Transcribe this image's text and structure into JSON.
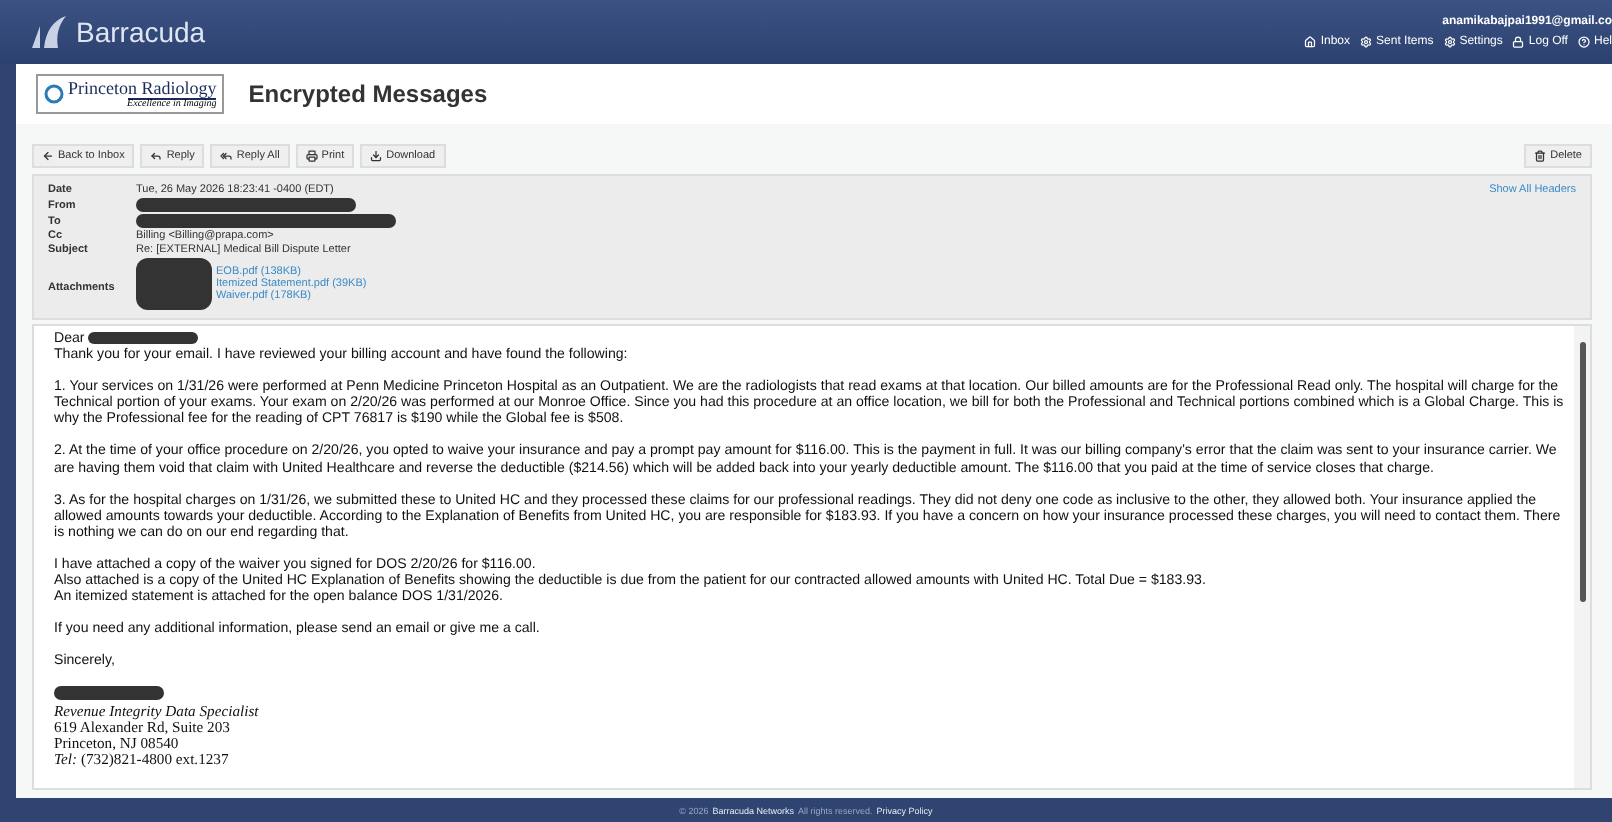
{
  "topbar": {
    "brand": "Barracuda",
    "user": "anamikabajpai1991@gmail.co",
    "nav": [
      {
        "label": "Inbox"
      },
      {
        "label": "Sent Items"
      },
      {
        "label": "Settings"
      },
      {
        "label": "Log Off"
      },
      {
        "label": "Hel"
      }
    ]
  },
  "header": {
    "logo_name": "Princeton Radiology",
    "logo_tagline": "Excellence in Imaging",
    "title": "Encrypted Messages"
  },
  "toolbar": {
    "left": [
      {
        "label": "Back to Inbox"
      },
      {
        "label": "Reply"
      },
      {
        "label": "Reply All"
      },
      {
        "label": "Print"
      },
      {
        "label": "Download"
      }
    ],
    "right": [
      {
        "label": "Delete"
      }
    ]
  },
  "message_headers": {
    "show_all": "Show All Headers",
    "fields": [
      {
        "label": "Date",
        "kind": "text",
        "value": "Tue, 26 May 2026 18:23:41 -0400 (EDT)"
      },
      {
        "label": "From",
        "kind": "redacted"
      },
      {
        "label": "To",
        "kind": "redacted"
      },
      {
        "label": "Cc",
        "kind": "text",
        "value": "Billing <Billing@prapa.com>"
      },
      {
        "label": "Subject",
        "kind": "text",
        "value": "Re: [EXTERNAL] Medical Bill Dispute Letter"
      }
    ],
    "attachments_label": "Attachments",
    "attachments": [
      "EOB.pdf (138KB)",
      "Itemized Statement.pdf (39KB)",
      "Waiver.pdf (178KB)"
    ]
  },
  "body": {
    "greeting": "Dear",
    "paragraphs": [
      [
        "Thank you for your email.  I have reviewed your billing account and have found the following:"
      ],
      [
        "1. Your services on 1/31/26 were performed at Penn Medicine Princeton Hospital as an Outpatient.  We are the radiologists that read exams at that location.  Our billed amounts are for the Professional Read only. The hospital will charge for the Technical portion of your exams.  Your exam on 2/20/26 was performed at our Monroe Office.  Since you had this procedure at an office location, we bill for both the Professional and Technical portions combined which is a Global Charge. This is why the Professional fee for the reading of CPT 76817 is $190 while the Global fee is $508."
      ],
      [
        "2. At the time of your office procedure on 2/20/26, you opted to waive your insurance and pay a prompt pay amount for $116.00.  This is the payment in full.  It was our billing company's error that the claim was sent to your insurance carrier. We are having them void that claim with United Healthcare and reverse the deductible ($214.56) which will be added back into your yearly deductible amount. The $116.00 that you paid at the time of service closes that charge."
      ],
      [
        "3. As for the hospital charges on 1/31/26, we submitted these to United HC and they processed these claims for our professional readings.  They did not deny one code as inclusive to the other, they allowed both.  Your insurance applied the allowed amounts towards your deductible.  According to the Explanation of Benefits from United HC, you are responsible for $183.93.  If you have a concern on how your insurance processed these charges, you will need to contact them. There is nothing we can do on our end regarding that."
      ],
      [
        "I have attached a copy of the waiver you signed for DOS 2/20/26 for $116.00.",
        "Also attached is a copy of the United HC Explanation of Benefits showing the deductible is due from the patient for our contracted allowed amounts with United HC. Total Due = $183.93.",
        "An itemized statement is attached for the open balance DOS 1/31/2026."
      ],
      [
        "If you need any additional information, please send an email or give me a call."
      ],
      [
        "Sincerely,"
      ]
    ],
    "signature": {
      "title": "Revenue Integrity Data Specialist",
      "lines": [
        "619 Alexander Rd, Suite 203",
        "Princeton, NJ 08540"
      ],
      "tel_label": "Tel:",
      "tel": "(732)821-4800 ext.1237"
    }
  },
  "footer": {
    "copyright": "© 2026",
    "company": "Barracuda Networks",
    "rights": "All rights reserved.",
    "privacy": "Privacy Policy"
  }
}
